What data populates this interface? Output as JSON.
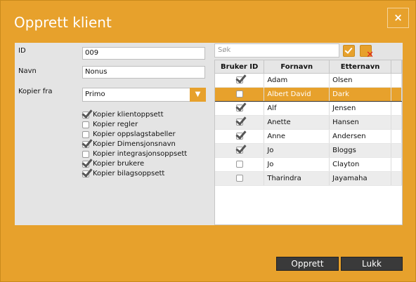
{
  "dialog": {
    "title": "Opprett klient",
    "close_label": "×"
  },
  "form": {
    "id_label": "ID",
    "id_value": "009",
    "name_label": "Navn",
    "name_value": "Nonus",
    "copy_from_label": "Kopier fra",
    "copy_from_value": "Primo",
    "options": [
      {
        "label": "Kopier klientoppsett",
        "checked": true
      },
      {
        "label": "Kopier regler",
        "checked": false
      },
      {
        "label": "Kopier oppslagstabeller",
        "checked": false
      },
      {
        "label": "Kopier Dimensjonsnavn",
        "checked": true
      },
      {
        "label": "Kopier integrasjonsoppsett",
        "checked": false
      },
      {
        "label": "Kopier brukere",
        "checked": true
      },
      {
        "label": "Kopier bilagsoppsett",
        "checked": true
      }
    ]
  },
  "search": {
    "placeholder": "Søk"
  },
  "users_table": {
    "headers": [
      "Bruker ID",
      "Fornavn",
      "Etternavn"
    ],
    "rows": [
      {
        "checked": true,
        "first": "Adam",
        "last": "Olsen"
      },
      {
        "checked": false,
        "first": "Albert David",
        "last": "Dark",
        "selected": true
      },
      {
        "checked": true,
        "first": "Alf",
        "last": "Jensen"
      },
      {
        "checked": true,
        "first": "Anette",
        "last": "Hansen"
      },
      {
        "checked": true,
        "first": "Anne",
        "last": "Andersen"
      },
      {
        "checked": true,
        "first": "Jo",
        "last": "Bloggs"
      },
      {
        "checked": false,
        "first": "Jo",
        "last": "Clayton"
      },
      {
        "checked": false,
        "first": "Tharindra",
        "last": "Jayamaha"
      }
    ]
  },
  "footer": {
    "create_label": "Opprett",
    "close_label": "Lukk"
  },
  "colors": {
    "accent": "#e7a12c",
    "panel": "#e4e4e4",
    "button": "#3a3a3a"
  }
}
